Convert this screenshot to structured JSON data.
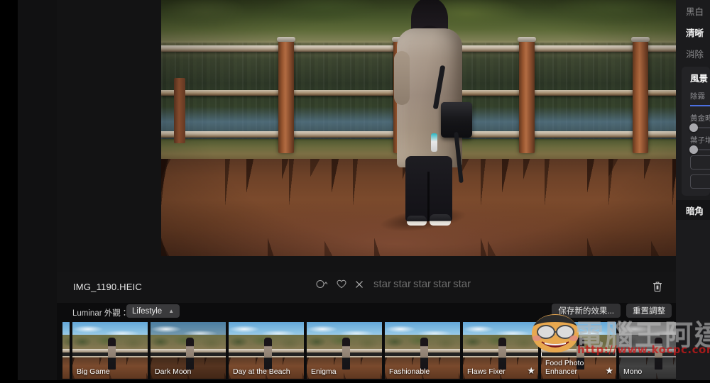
{
  "photo": {
    "filename": "IMG_1190.HEIC",
    "alt_description": "Person in long beige coat standing on reddish dirt path facing a wooden fence over a pond"
  },
  "infobar": {
    "icons": {
      "color_label": "circle-chevron-icon",
      "favorite": "heart-icon",
      "reject": "x-icon",
      "delete": "trash-icon"
    },
    "stars": [
      "star",
      "star",
      "star",
      "star",
      "star"
    ],
    "star_rating": 0
  },
  "looks": {
    "label": "Luminar 外觀：",
    "selected_category": "Lifestyle",
    "caret": "caret-up-icon",
    "save_button": "保存新的效果...",
    "reset_button": "重置調整",
    "thumbnails": [
      {
        "label": "Big Game",
        "starred": false,
        "selected": false,
        "style": ""
      },
      {
        "label": "Dark Moon",
        "starred": false,
        "selected": false,
        "style": "dark"
      },
      {
        "label": "Day at the Beach",
        "starred": false,
        "selected": false,
        "style": ""
      },
      {
        "label": "Enigma",
        "starred": false,
        "selected": false,
        "style": ""
      },
      {
        "label": "Fashionable",
        "starred": false,
        "selected": false,
        "style": ""
      },
      {
        "label": "Flaws Fixer",
        "starred": true,
        "selected": false,
        "style": ""
      },
      {
        "label": "Food Photo Enhancer",
        "starred": true,
        "selected": true,
        "style": ""
      },
      {
        "label": "Mono",
        "starred": false,
        "selected": false,
        "style": "mono"
      }
    ]
  },
  "sidebar": {
    "items": [
      {
        "label": "黑白",
        "active": false
      },
      {
        "label": "清晰",
        "active": true
      },
      {
        "label": "消除",
        "active": false
      }
    ],
    "panel": {
      "title": "風景",
      "sliders": [
        {
          "label": "除霧",
          "knob_pct": 96,
          "has_fill": true
        },
        {
          "label": "黃金時",
          "knob_pct": 6,
          "has_fill": false
        },
        {
          "label": "葉子增",
          "knob_pct": 6,
          "has_fill": false
        }
      ],
      "buttons": [
        "",
        ""
      ]
    },
    "footer": {
      "label": "暗角"
    }
  },
  "watermark": {
    "title": "電腦王阿達",
    "url": "http://www.kocpc.com.tw"
  },
  "colors": {
    "accent_blue": "#4b6fe0",
    "panel_bg": "#1b1b1d",
    "canvas_bg": "#141415",
    "strip_bg": "#0c0c0d",
    "watermark_red": "#c41a1a"
  }
}
